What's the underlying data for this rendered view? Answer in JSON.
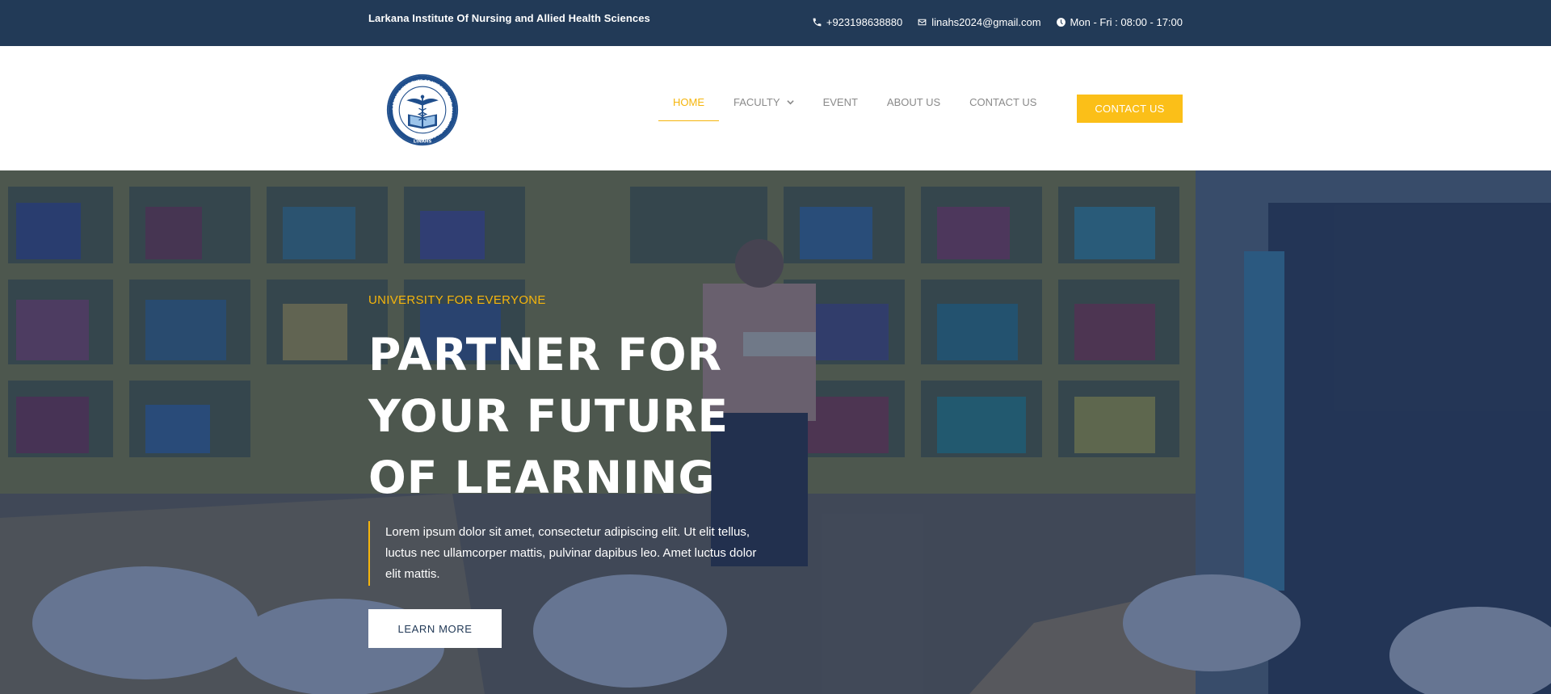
{
  "topbar": {
    "brand": "Larkana Institute Of Nursing and Allied Health Sciences",
    "phone": "+923198638880",
    "email": "linahs2024@gmail.com",
    "hours": "Mon - Fri : 08:00 - 17:00",
    "icons": {
      "phone": "phone-icon",
      "email": "envelope-icon",
      "hours": "clock-icon"
    }
  },
  "header": {
    "logo": {
      "name": "linahs-logo",
      "ring_text": "LARKANA INSTITUTE OF NURSING AND ALLIED HEALTH SCIENCES",
      "bottom_text": "LINAHS"
    },
    "nav": [
      {
        "label": "HOME",
        "active": true
      },
      {
        "label": "FACULTY",
        "has_dropdown": true
      },
      {
        "label": "EVENT"
      },
      {
        "label": "ABOUT US"
      },
      {
        "label": "CONTACT US"
      }
    ],
    "cta_label": "CONTACT US"
  },
  "hero": {
    "eyebrow": "UNIVERSITY FOR EVERYONE",
    "headline_lines": [
      "PARTNER FOR",
      "YOUR FUTURE",
      "OF LEARNING"
    ],
    "description": "Lorem ipsum dolor sit amet, consectetur adipiscing elit. Ut elit tellus, luctus nec ullamcorper mattis, pulvinar dapibus leo. Amet luctus dolor elit mattis.",
    "button_label": "LEARN MORE",
    "background": "library-photo"
  },
  "colors": {
    "topbar": "#223a57",
    "accent": "#fbbf18",
    "nav_text": "#8a8a8a",
    "hero_overlay": "#1c325a",
    "white": "#ffffff"
  }
}
